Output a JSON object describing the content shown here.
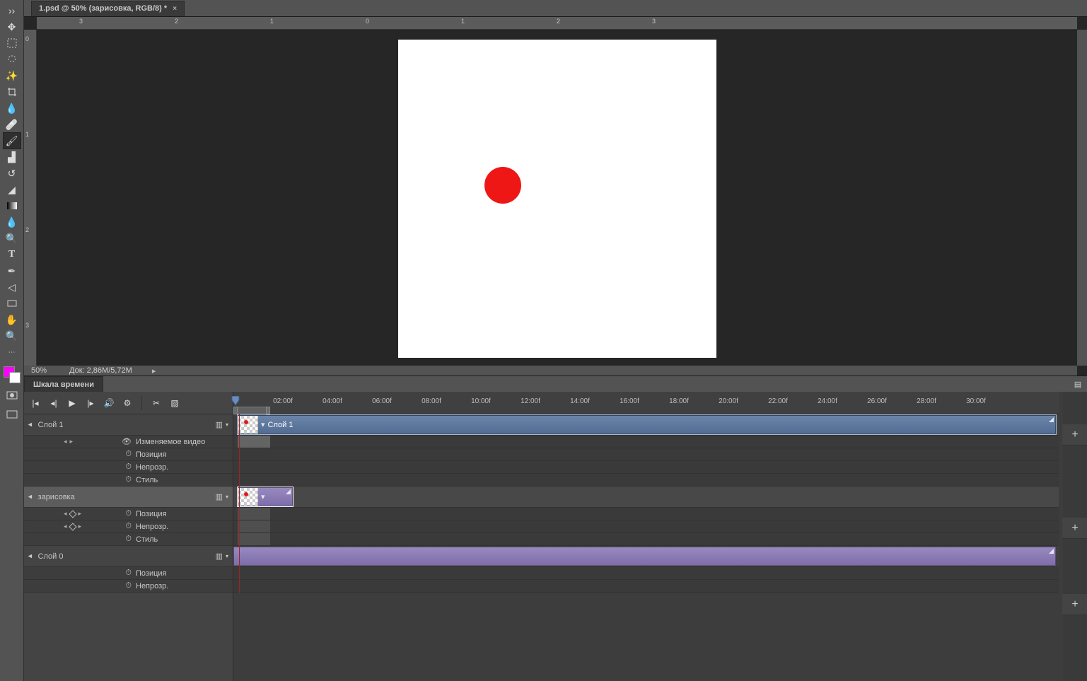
{
  "tab_title": "1.psd @ 50% (зарисовка, RGB/8) *",
  "zoom": "50%",
  "doc_info": "Док: 2,86M/5,72M",
  "timeline_panel_name": "Шкала времени",
  "ruler_h": [
    "3",
    "2",
    "1",
    "0",
    "1",
    "2",
    "3"
  ],
  "ruler_v": [
    "0",
    "1",
    "2",
    "3"
  ],
  "timeline_ticks": [
    "02:00f",
    "04:00f",
    "06:00f",
    "08:00f",
    "10:00f",
    "12:00f",
    "14:00f",
    "16:00f",
    "18:00f",
    "20:00f",
    "22:00f",
    "24:00f",
    "26:00f",
    "28:00f",
    "30:00f"
  ],
  "colors": {
    "fg": "#ff00ff",
    "bg": "#ffffff",
    "accent": "#ef1616"
  },
  "layers": [
    {
      "name": "Слой 1",
      "expanded": true,
      "selected": false,
      "clip_label": "Слой 1",
      "clip_color": "blue",
      "props": [
        {
          "label": "Изменяемое видео",
          "hasVideo": true,
          "nav": true,
          "visible": true
        },
        {
          "label": "Позиция",
          "stopwatch": true
        },
        {
          "label": "Непрозр.",
          "stopwatch": true
        },
        {
          "label": "Стиль",
          "stopwatch": true
        }
      ]
    },
    {
      "name": "зарисовка",
      "expanded": true,
      "selected": true,
      "clip_color": "purple",
      "props": [
        {
          "label": "Позиция",
          "stopwatch": true,
          "nav": true,
          "diamond": true
        },
        {
          "label": "Непрозр.",
          "stopwatch": true,
          "nav": true,
          "diamond": true
        },
        {
          "label": "Стиль",
          "stopwatch": true
        }
      ]
    },
    {
      "name": "Слой 0",
      "expanded": true,
      "selected": false,
      "clip_color": "purple_full",
      "props": [
        {
          "label": "Позиция",
          "stopwatch": true
        },
        {
          "label": "Непрозр.",
          "stopwatch": true
        }
      ]
    }
  ]
}
